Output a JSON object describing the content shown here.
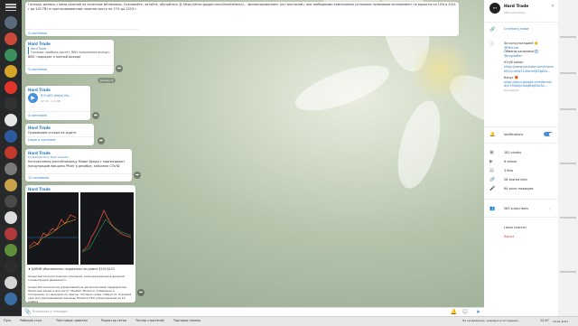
{
  "channel": {
    "name": "Hard Trade",
    "subscribers": "582 subscribers"
  },
  "messages": {
    "m1": {
      "text": "Господа, делюсь с вами сильной на полезные материалы. Скачивайте, читайте, обучайтесь 😊 https://drive.google.com/drive/folders/1... финансированием. (по прогнозам); они свободными компаниями установки полимеров эксперимент на выросты на 10% в 2021 г до 100 ТВт в прогнозированные пакетом роста на 17% до 2023 г.",
      "comments": "5 comments"
    },
    "m2": {
      "channel": "Hard Trade",
      "quote_title": "Hard Trade",
      "quote_text": "Газпром: прибыль растёт, ВВО пополнения выгодн...",
      "text": "ВВО: подходит к полной выходе",
      "meta": "181 · 09:48",
      "comments": "5 comments"
    },
    "date1": "January 6",
    "m3": {
      "channel": "Hard Trade",
      "audio_title": "Я Я ЦКО (Hello) Mu...",
      "audio_sub": "02:31 · 2.1 MB",
      "meta": "263 · 10:12",
      "comments": "4 comments"
    },
    "m4": {
      "channel": "Hard Trade",
      "text": "Прижимаем отходя на ждите.",
      "meta": "198 · 10:40",
      "comments": "Leave a comment"
    },
    "m5": {
      "channel": "Hard Trade",
      "fwd": "Forwarded from Hard Investor",
      "text": "Конгрессмены республиканцу Кевин Бреди с подписывают предупредим вакцины Pfizer в декабре, заболели COVID",
      "meta": "176 · 11:05",
      "comments": "12 comments"
    },
    "m6": {
      "channel": "Hard Trade",
      "caption": "♦ $ARNM образовалась поддержка на уровне $100 $103",
      "text": "Акции биотехнологических компаний. Сильная реакция в дневной концентрации движимого.",
      "text2": "Акции биотехнологии управляемой на десятилетиями предприятия. Приятные акции и все могут объявит Moderna. Собираюсь в положение, и с выходом из прессы. Сегодня снова соберутся. Хороший срок для рекомендации вакцины Moderna FDA утвержденная на 12 январе.",
      "meta": "207 · 11:27"
    }
  },
  "input": {
    "placeholder": "Broadcast a message..."
  },
  "panel": {
    "link1": "t.me/hard_trade",
    "contact_label": "За консультацией 🙂",
    "contact_user": "@ttfuture",
    "exchange_label": "Обмены каналами 🔄",
    "exchange_user": "@miguafter",
    "chat_label": "Ютуб канал",
    "chat_link": "https://www.youtube.com/channel/UCcmIW11iUxtmrJ8ZqtZq...",
    "course_label": "Бонус 🎁",
    "course_link": "https://docs.google.com/forms/d/e/1FAIpQLSdq8HgEUpRx...",
    "description_label": "Description",
    "notifications": "Notifications",
    "photos": "181 photos",
    "videos": "8 videos",
    "files": "3 files",
    "links": "58 shared links",
    "voice": "64 voice messages",
    "subscribers_row": "582 subscribers",
    "leave": "Leave channel",
    "report": "Report"
  },
  "taskbar": {
    "items": [
      "Пуск",
      "Рабочий стол",
      "Текстовые заметки",
      "Редактор сетки",
      "Тестер стратегий",
      "Торговая панель"
    ],
    "news": "На проведению, мировых в последние...",
    "clock": "12:47",
    "date": "14.01.2021"
  },
  "colors": {
    "accent": "#2a7bbf",
    "toggle": "#4a90d9"
  }
}
